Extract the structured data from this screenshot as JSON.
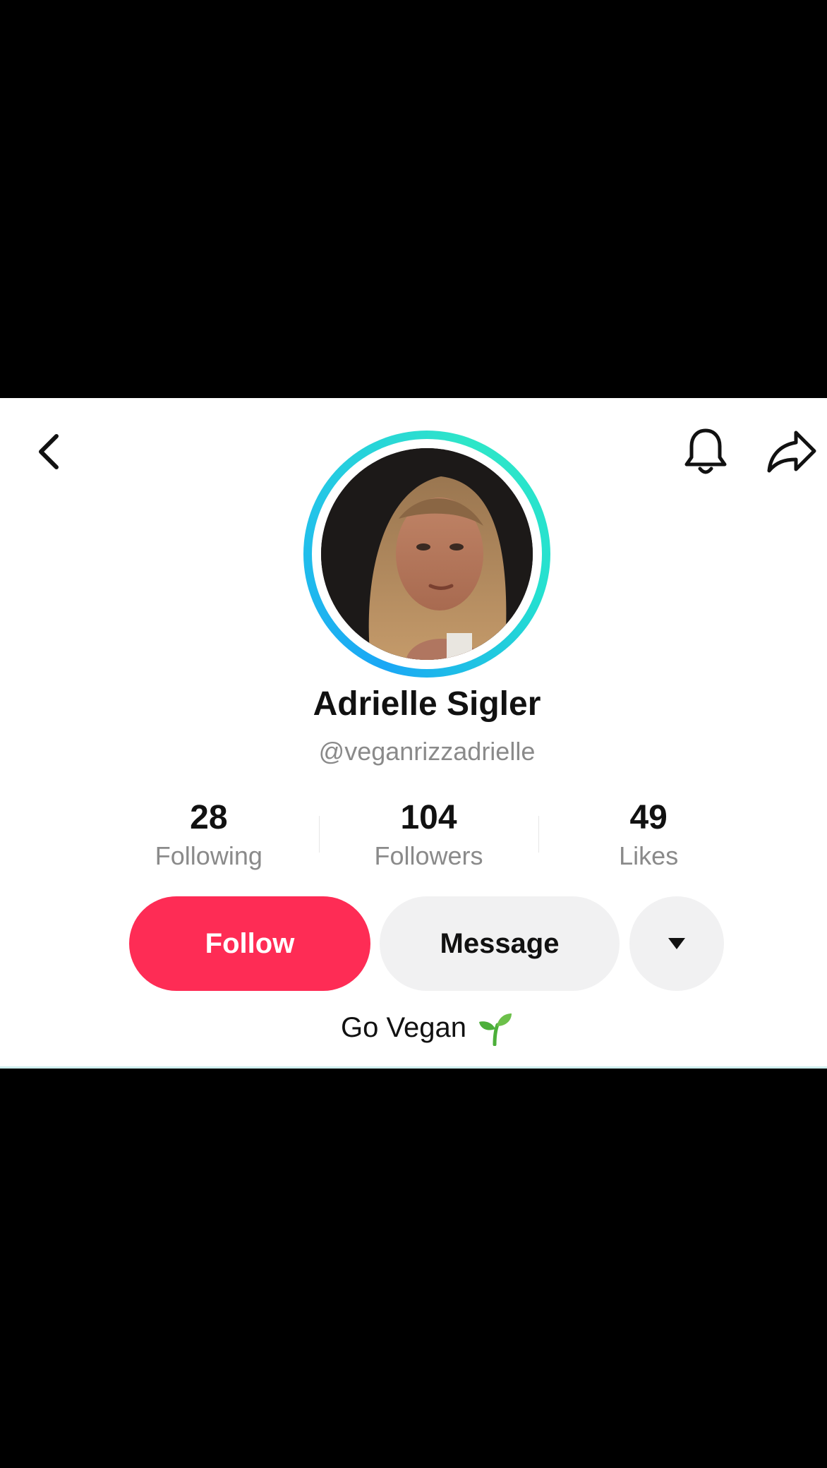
{
  "profile": {
    "display_name": "Adrielle Sigler",
    "username": "@veganrizzadrielle",
    "bio_text": "Go Vegan",
    "bio_emoji": "seedling-icon"
  },
  "stats": [
    {
      "value": "28",
      "label": "Following"
    },
    {
      "value": "104",
      "label": "Followers"
    },
    {
      "value": "49",
      "label": "Likes"
    }
  ],
  "actions": {
    "follow_label": "Follow",
    "message_label": "Message",
    "more_icon": "caret-down-icon"
  },
  "nav": {
    "back_icon": "chevron-left-icon",
    "notify_icon": "bell-icon",
    "share_icon": "share-arrow-icon"
  },
  "colors": {
    "follow": "#fe2c55",
    "secondary_button": "#f1f1f2",
    "avatar_ring_start": "#1aa7f5",
    "avatar_ring_end": "#2ee6c8",
    "muted_text": "#8a8a8a"
  }
}
